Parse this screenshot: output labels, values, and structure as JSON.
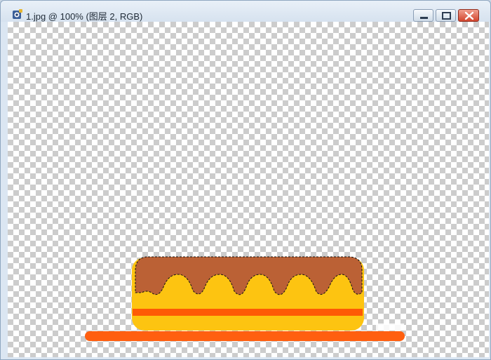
{
  "window": {
    "title": "1.jpg @ 100% (图层 2, RGB)",
    "icons": {
      "app": "photoshop-document-icon",
      "minimize": "minimize-icon",
      "maximize": "maximize-icon",
      "close": "close-icon"
    }
  },
  "artwork": {
    "description_colors": {
      "cake_body": "#fdc411",
      "icing": "#bb6135",
      "stripe": "#fe5a05",
      "plate": "#ff5f10"
    }
  }
}
